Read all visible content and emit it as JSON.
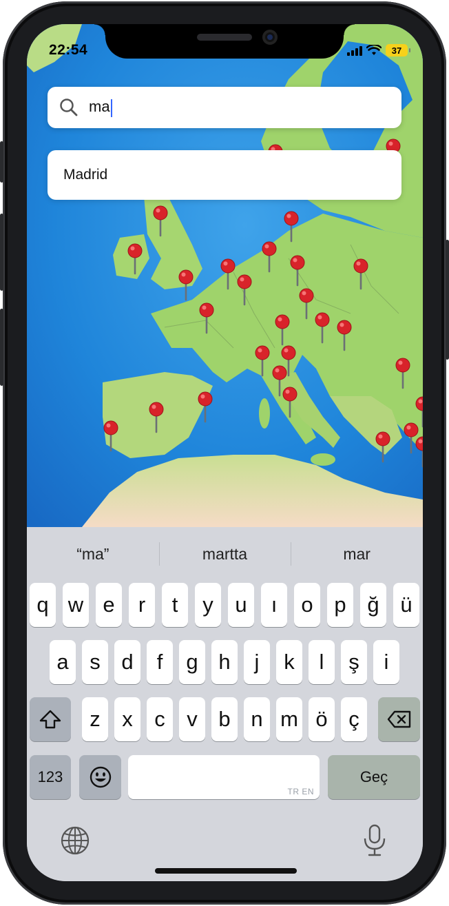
{
  "status_bar": {
    "time": "22:54",
    "battery": "37"
  },
  "search": {
    "value": "ma"
  },
  "suggestions": [
    {
      "label": "Madrid"
    }
  ],
  "keyboard": {
    "predictions": [
      "“ma”",
      "martta",
      "mar"
    ],
    "row1": [
      "q",
      "w",
      "e",
      "r",
      "t",
      "y",
      "u",
      "ı",
      "o",
      "p",
      "ğ",
      "ü"
    ],
    "row2": [
      "a",
      "s",
      "d",
      "f",
      "g",
      "h",
      "j",
      "k",
      "l",
      "ş",
      "i"
    ],
    "row3": [
      "z",
      "x",
      "c",
      "v",
      "b",
      "n",
      "m",
      "ö",
      "ç"
    ],
    "numbers_label": "123",
    "space_hint": "TR EN",
    "return_label": "Geç"
  },
  "icons": {
    "search": "search-icon",
    "shift": "shift-icon",
    "delete": "delete-icon",
    "emoji": "emoji-icon",
    "globe": "globe-icon",
    "mic": "microphone-icon",
    "pin": "map-pin-icon"
  },
  "colors": {
    "caret": "#3366ff",
    "pin_head": "#d8232a",
    "battery": "#f6d11b",
    "ocean": "#1e7fd6",
    "land": "#9fd36b"
  }
}
